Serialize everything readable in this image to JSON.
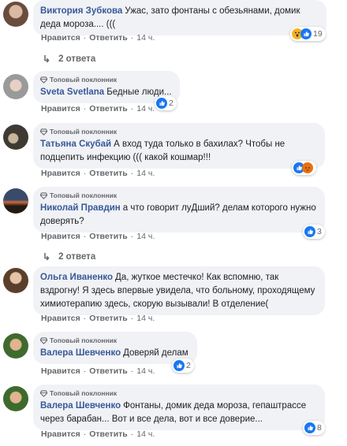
{
  "common": {
    "like_label": "Нравится",
    "reply_label": "Ответить",
    "dot": "·",
    "fan_badge": "Топовый поклонник"
  },
  "colors": {
    "link": "#385898",
    "bubble": "#f0f2f5",
    "like_blue": "#1877f2"
  },
  "comments": [
    {
      "author": "Виктория Зубкова",
      "text": "Ужас, зато фонтаны с обезьянами, домик деда мороза.... (((",
      "time": "14 ч.",
      "reactions": [
        "wow-icon",
        "like-icon"
      ],
      "reaction_count": "19",
      "fan": false
    },
    {
      "author": "Sveta Svetlana",
      "text": "Бедные люди...",
      "time": "14 ч.",
      "reactions": [
        "like-icon"
      ],
      "reaction_count": "2",
      "fan": true
    },
    {
      "author": "Татьяна Скубай",
      "text": "А вход туда только в бахилах? Чтобы не подцепить инфекцию ((( какой кошмар!!!",
      "time": "14 ч.",
      "reactions": [
        "like-icon",
        "angry-icon"
      ],
      "reaction_count": "",
      "fan": true
    },
    {
      "author": "Николай Правдин",
      "text": "а что говорит луДший? делам которого нужно доверять?",
      "time": "14 ч.",
      "reactions": [
        "like-icon"
      ],
      "reaction_count": "3",
      "fan": true
    },
    {
      "author": "Ольга Иваненко",
      "text": "Да, жуткое местечко! Как вспомню, так вздрогну! Я здесь впервые увидела, что больному, проходящему химиотерапию здесь, скорую вызывали! В отделение(",
      "time": "14 ч.",
      "fan": true
    },
    {
      "author": "Валера Шевченко",
      "text": "Доверяй делам",
      "time": "14 ч.",
      "reactions": [
        "like-icon"
      ],
      "reaction_count": "2",
      "fan": true
    },
    {
      "author": "Валера Шевченко",
      "text": "Фонтаны, домик деда мороза, гепаштрассе через барабан... Вот и все дела, вот и все доверие...",
      "time": "14 ч.",
      "reactions": [
        "like-icon"
      ],
      "reaction_count": "8",
      "fan": true
    }
  ],
  "replies": [
    {
      "label": "2 ответа"
    },
    {
      "label": "2 ответа"
    }
  ]
}
